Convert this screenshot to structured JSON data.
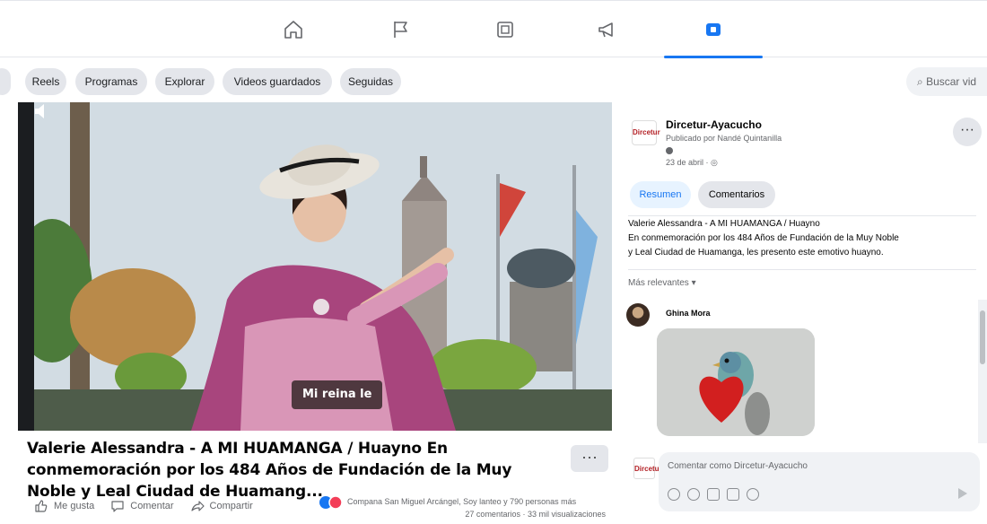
{
  "top_nav": {
    "items": [
      {
        "id": "home",
        "icon": "home-icon",
        "active": false
      },
      {
        "id": "pages",
        "icon": "flag-icon",
        "active": false
      },
      {
        "id": "marketplace",
        "icon": "marketplace-icon",
        "active": false
      },
      {
        "id": "ads",
        "icon": "megaphone-icon",
        "active": false
      },
      {
        "id": "video",
        "icon": "video-icon",
        "active": true
      }
    ],
    "accent_color": "#1877f2"
  },
  "filters": {
    "chips": [
      "Reels",
      "Programas",
      "Explorar",
      "Videos guardados",
      "Seguidas"
    ],
    "search_placeholder": "Buscar vid"
  },
  "video": {
    "subtitle_overlay": "Mi reina le",
    "title": "Valerie Alessandra - A MI HUAMANGA / Huayno En conmemoración por los 484 Años de Fundación de la Muy Noble y Leal Ciudad de Huamang...",
    "more_label": "···",
    "actions": [
      "Me gusta",
      "Comentar",
      "Compartir"
    ],
    "reactions_text": "Compana San Miguel Arcángel, Soy lanteo y 790 personas más",
    "stats_text": "27 comentarios · 33 mil visualizaciones"
  },
  "post": {
    "page_avatar_text": "Dircetur",
    "page_name": "Dircetur-Ayacucho",
    "posted_by": "Publicado por Nandé Quintanilla",
    "date": "23 de abril · ",
    "tabs": [
      "Resumen",
      "Comentarios"
    ],
    "description_lines": [
      "Valerie Alessandra - A MI HUAMANGA / Huayno",
      "En conmemoración por los 484 Años de Fundación de la Muy Noble",
      "y Leal Ciudad de Huamanga, les presento este emotivo huayno."
    ],
    "relevance": "Más relevantes ▾",
    "comment": {
      "author": "Ghina Mora"
    },
    "composer_placeholder": "Comentar como Dircetur-Ayacucho",
    "more_label": "···"
  }
}
